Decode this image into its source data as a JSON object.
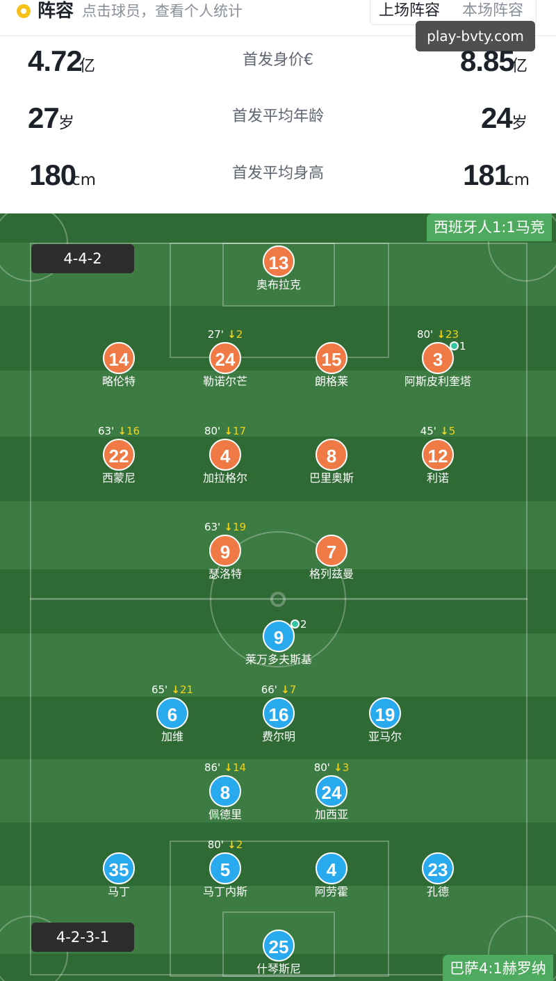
{
  "header": {
    "title": "阵容",
    "subtitle": "点击球员，查看个人统计",
    "tabs": [
      "上场阵容",
      "本场阵容"
    ]
  },
  "watermark": "play-bvty.com",
  "stats": [
    {
      "label": "首发身价€",
      "home_value": "4.72",
      "home_unit": "亿",
      "away_value": "8.85",
      "away_unit": "亿"
    },
    {
      "label": "首发平均年龄",
      "home_value": "27",
      "home_unit": "岁",
      "away_value": "24",
      "away_unit": "岁"
    },
    {
      "label": "首发平均身高",
      "home_value": "180",
      "home_unit": "cm",
      "away_value": "181",
      "away_unit": "cm"
    }
  ],
  "teams": {
    "home": {
      "formation": "4-4-2",
      "score_label": "西班牙人1:1马竞",
      "color": "#f07a45"
    },
    "away": {
      "formation": "4-2-3-1",
      "score_label": "巴萨4:1赫罗纳",
      "color": "#29a9ee"
    }
  },
  "players": [
    {
      "team": "home",
      "number": "13",
      "name": "奥布拉克",
      "sub_minute": "",
      "sub_number": "",
      "goals": ""
    },
    {
      "team": "home",
      "number": "14",
      "name": "略伦特",
      "sub_minute": "",
      "sub_number": "",
      "goals": ""
    },
    {
      "team": "home",
      "number": "24",
      "name": "勒诺尔芒",
      "sub_minute": "27'",
      "sub_number": "2",
      "goals": ""
    },
    {
      "team": "home",
      "number": "15",
      "name": "朗格莱",
      "sub_minute": "",
      "sub_number": "",
      "goals": ""
    },
    {
      "team": "home",
      "number": "3",
      "name": "阿斯皮利奎塔",
      "sub_minute": "80'",
      "sub_number": "23",
      "goals": "1"
    },
    {
      "team": "home",
      "number": "22",
      "name": "西蒙尼",
      "sub_minute": "63'",
      "sub_number": "16",
      "goals": ""
    },
    {
      "team": "home",
      "number": "4",
      "name": "加拉格尔",
      "sub_minute": "80'",
      "sub_number": "17",
      "goals": ""
    },
    {
      "team": "home",
      "number": "8",
      "name": "巴里奥斯",
      "sub_minute": "",
      "sub_number": "",
      "goals": ""
    },
    {
      "team": "home",
      "number": "12",
      "name": "利诺",
      "sub_minute": "45'",
      "sub_number": "5",
      "goals": ""
    },
    {
      "team": "home",
      "number": "9",
      "name": "瑟洛特",
      "sub_minute": "63'",
      "sub_number": "19",
      "goals": ""
    },
    {
      "team": "home",
      "number": "7",
      "name": "格列兹曼",
      "sub_minute": "",
      "sub_number": "",
      "goals": ""
    },
    {
      "team": "away",
      "number": "9",
      "name": "莱万多夫斯基",
      "sub_minute": "",
      "sub_number": "",
      "goals": "2"
    },
    {
      "team": "away",
      "number": "6",
      "name": "加维",
      "sub_minute": "65'",
      "sub_number": "21",
      "goals": ""
    },
    {
      "team": "away",
      "number": "16",
      "name": "费尔明",
      "sub_minute": "66'",
      "sub_number": "7",
      "goals": ""
    },
    {
      "team": "away",
      "number": "19",
      "name": "亚马尔",
      "sub_minute": "",
      "sub_number": "",
      "goals": ""
    },
    {
      "team": "away",
      "number": "8",
      "name": "佩德里",
      "sub_minute": "86'",
      "sub_number": "14",
      "goals": ""
    },
    {
      "team": "away",
      "number": "24",
      "name": "加西亚",
      "sub_minute": "80'",
      "sub_number": "3",
      "goals": ""
    },
    {
      "team": "away",
      "number": "35",
      "name": "马丁",
      "sub_minute": "",
      "sub_number": "",
      "goals": ""
    },
    {
      "team": "away",
      "number": "5",
      "name": "马丁内斯",
      "sub_minute": "80'",
      "sub_number": "2",
      "goals": ""
    },
    {
      "team": "away",
      "number": "4",
      "name": "阿劳霍",
      "sub_minute": "",
      "sub_number": "",
      "goals": ""
    },
    {
      "team": "away",
      "number": "23",
      "name": "孔德",
      "sub_minute": "",
      "sub_number": "",
      "goals": ""
    },
    {
      "team": "away",
      "number": "25",
      "name": "什琴斯尼",
      "sub_minute": "",
      "sub_number": "",
      "goals": ""
    }
  ]
}
